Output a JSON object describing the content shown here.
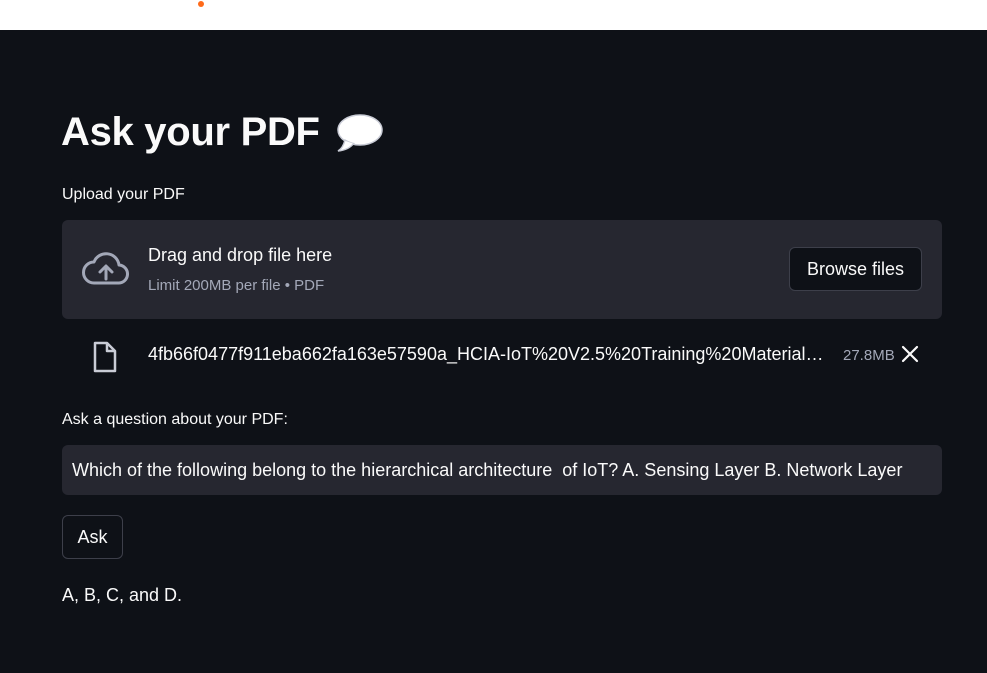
{
  "header": {
    "accent_color": "#ff6a1a"
  },
  "page": {
    "title": "Ask your PDF",
    "title_icon": "speech-bubble-icon"
  },
  "uploader": {
    "label": "Upload your PDF",
    "drag_text": "Drag and drop file here",
    "limit_text": "Limit 200MB per file • PDF",
    "browse_label": "Browse files",
    "icon": "cloud-upload-icon"
  },
  "uploaded_file": {
    "name": "4fb66f0477f911eba662fa163e57590a_HCIA-IoT%20V2.5%20Training%20Material…",
    "size": "27.8MB",
    "icon": "file-icon"
  },
  "question": {
    "label": "Ask a question about your PDF:",
    "value": "Which of the following belong to the hierarchical architecture  of IoT? A. Sensing Layer B. Network Layer"
  },
  "ask_button": {
    "label": "Ask"
  },
  "answer": {
    "text": "A, B, C, and D."
  },
  "colors": {
    "background": "#0e1117",
    "surface": "#262730",
    "text": "#fafafa",
    "muted_text": "#a3a8b8"
  }
}
